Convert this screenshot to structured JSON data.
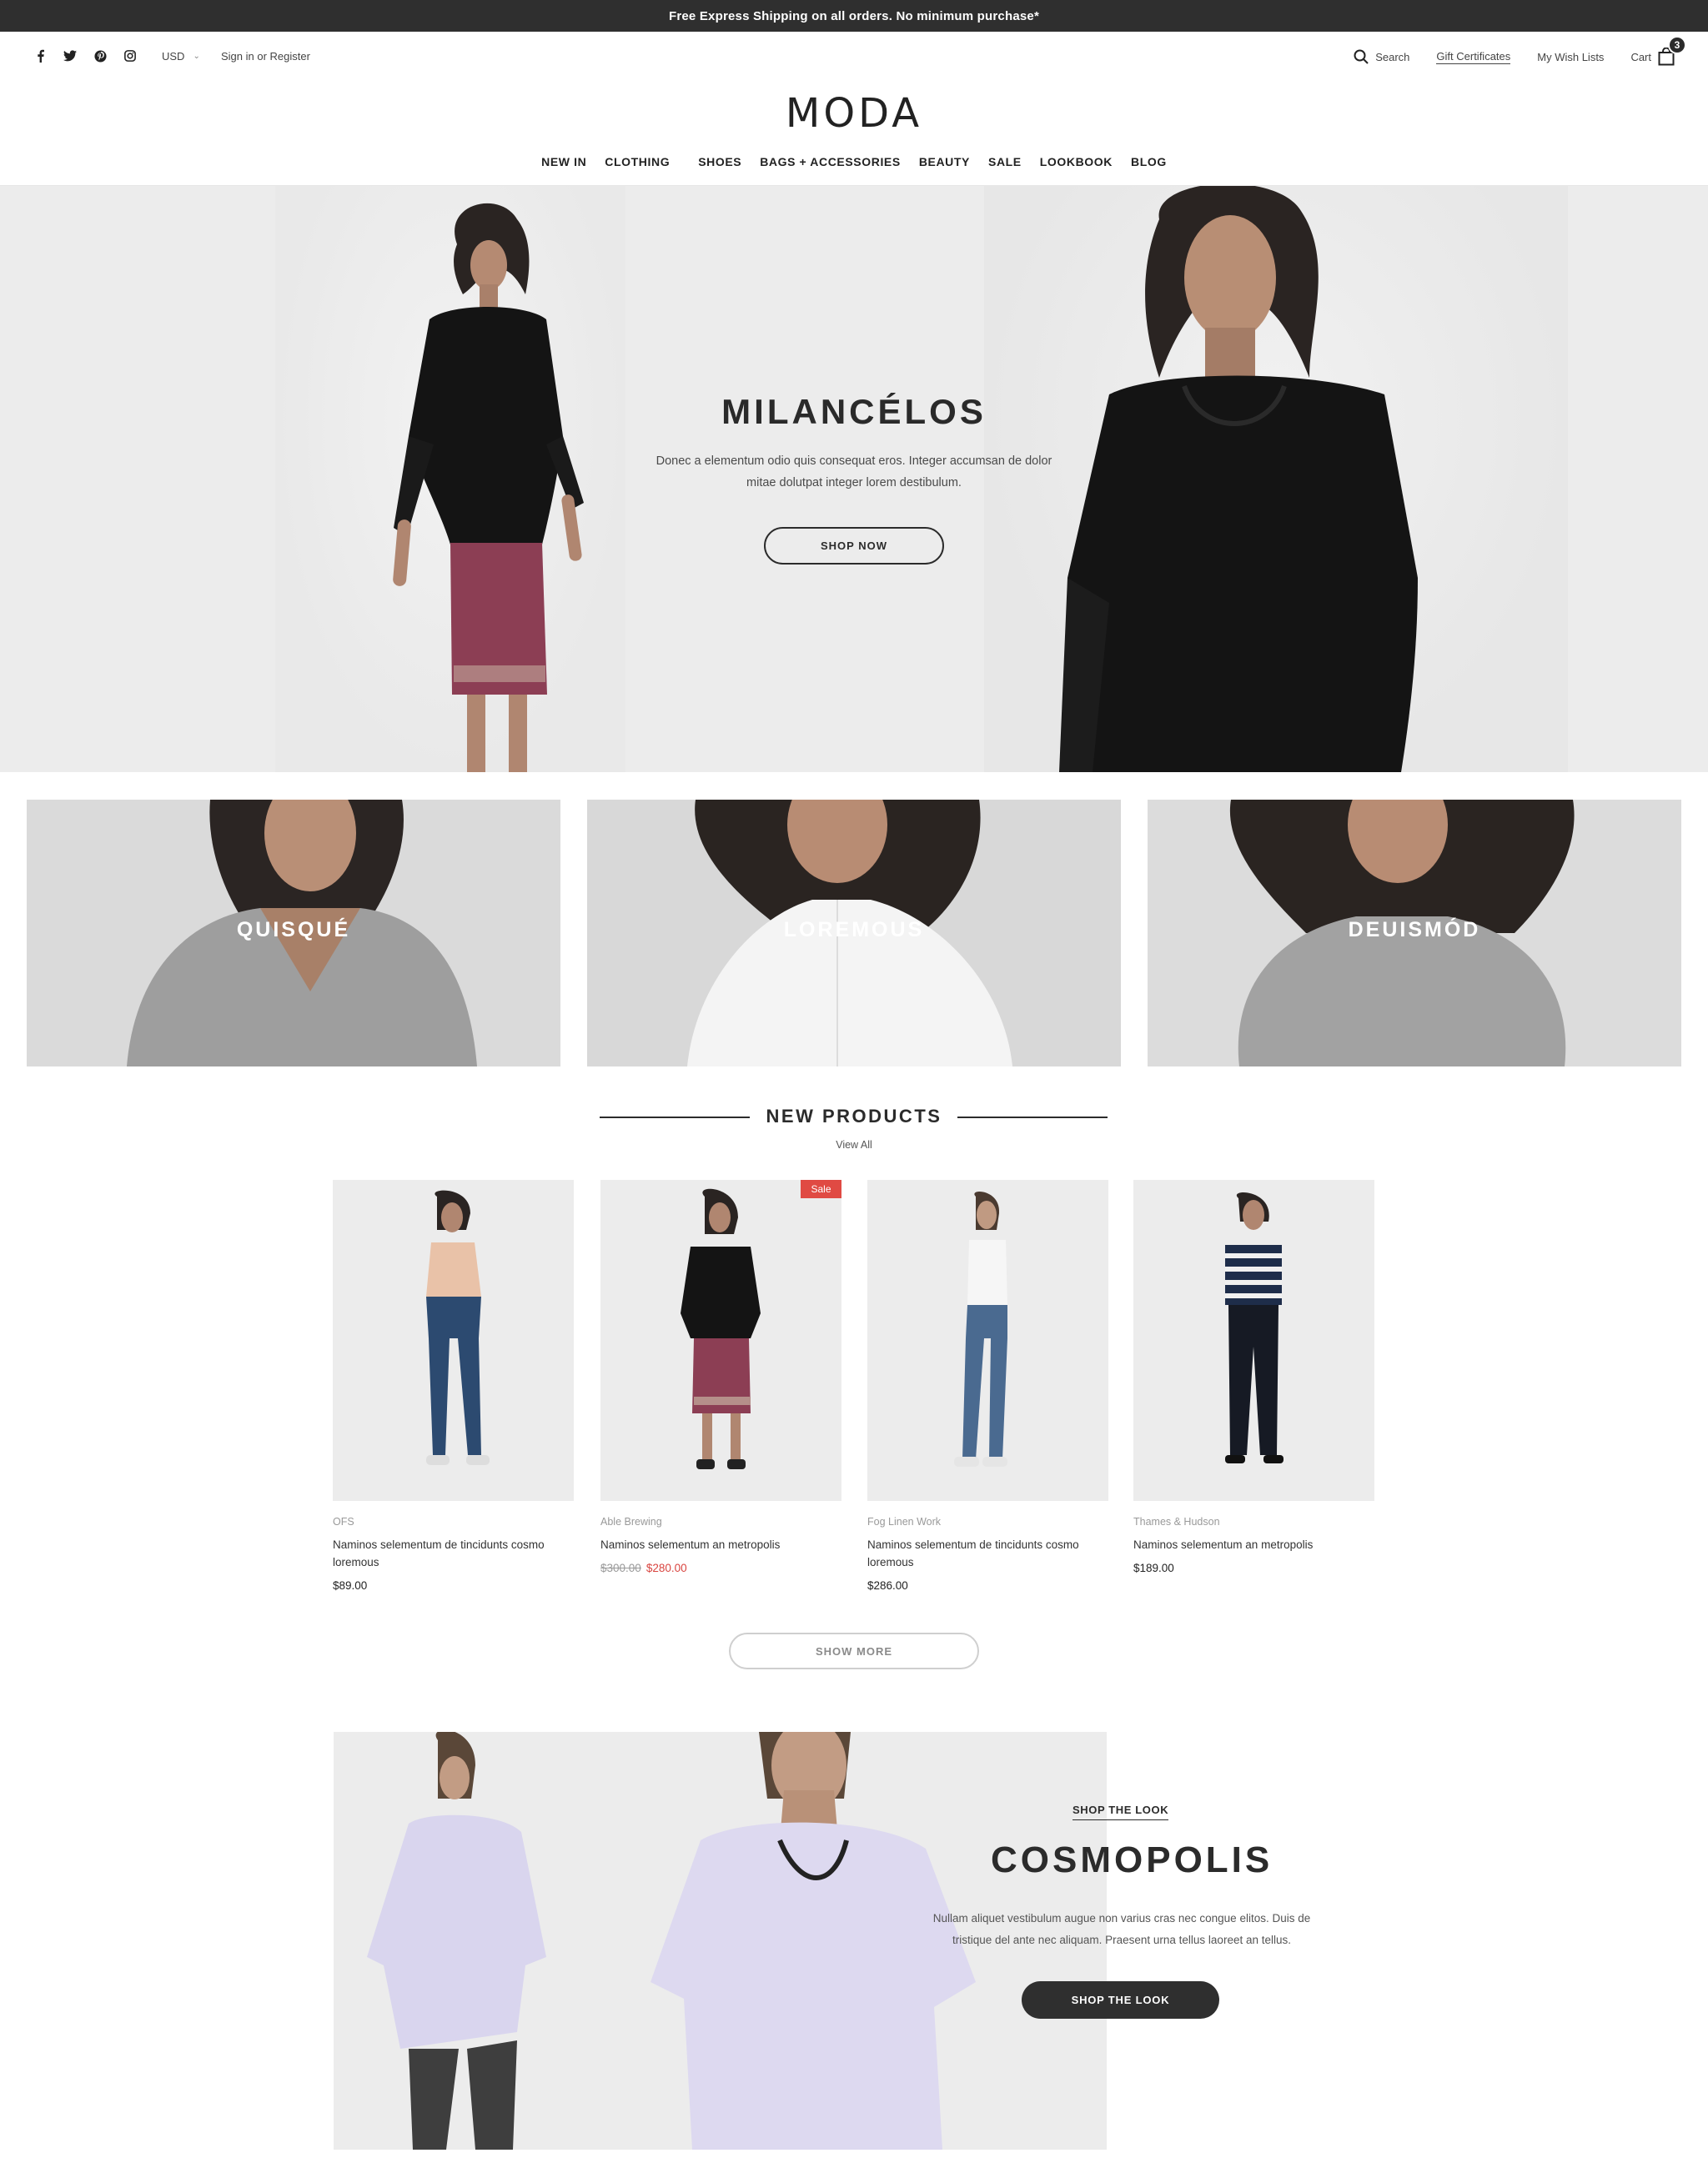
{
  "announcement": "Free Express Shipping on all orders. No minimum purchase*",
  "utility": {
    "social": [
      {
        "icon": "facebook-icon",
        "glyph": "f"
      },
      {
        "icon": "twitter-icon",
        "glyph": "🐦"
      },
      {
        "icon": "pinterest-icon",
        "glyph": "℗"
      },
      {
        "icon": "instagram-icon",
        "glyph": "◻"
      }
    ],
    "currency": "USD",
    "signin": "Sign in or Register",
    "search": "Search",
    "gift": "Gift Certificates",
    "wishlist": "My Wish Lists",
    "cart": "Cart",
    "cart_count": "3"
  },
  "logo": "MODA",
  "nav": [
    "NEW IN",
    "CLOTHING",
    "SHOES",
    "BAGS + ACCESSORIES",
    "BEAUTY",
    "SALE",
    "LOOKBOOK",
    "BLOG"
  ],
  "hero": {
    "title": "MILANCÉLOS",
    "subtitle": "Donec a elementum odio quis consequat eros. Integer accumsan de dolor mitae dolutpat integer lorem destibulum.",
    "button": "SHOP NOW"
  },
  "categories": [
    "QUISQUÉ",
    "LOREMOUS",
    "DEUISMÓD"
  ],
  "new_products": {
    "title": "NEW PRODUCTS",
    "view_all": "View All",
    "show_more": "SHOW MORE",
    "items": [
      {
        "brand": "OFS",
        "name": "Naminos selementum de tinciduntscosmo loremous",
        "name_display": "Naminos selementum de tincidunts cosmo loremous",
        "price": "$89.00",
        "old_price": "",
        "sale": ""
      },
      {
        "brand": "Able Brewing",
        "name_display": "Naminos selementum an metropolis",
        "price": "$280.00",
        "old_price": "$300.00",
        "sale": "Sale"
      },
      {
        "brand": "Fog Linen Work",
        "name_display": "Naminos selementum de tincidunts cosmo loremous",
        "price": "$286.00",
        "old_price": "",
        "sale": ""
      },
      {
        "brand": "Thames & Hudson",
        "name_display": "Naminos selementum an metropolis",
        "price": "$189.00",
        "old_price": "",
        "sale": ""
      }
    ],
    "sale_color": "#e04a43"
  },
  "look": {
    "tag": "SHOP THE LOOK",
    "title": "COSMOPOLIS",
    "subtitle": "Nullam aliquet vestibulum augue non varius cras nec congue elitos. Duis de tristique del ante nec aliquam. Praesent urna tellus laoreet an tellus.",
    "button": "SHOP THE LOOK"
  }
}
